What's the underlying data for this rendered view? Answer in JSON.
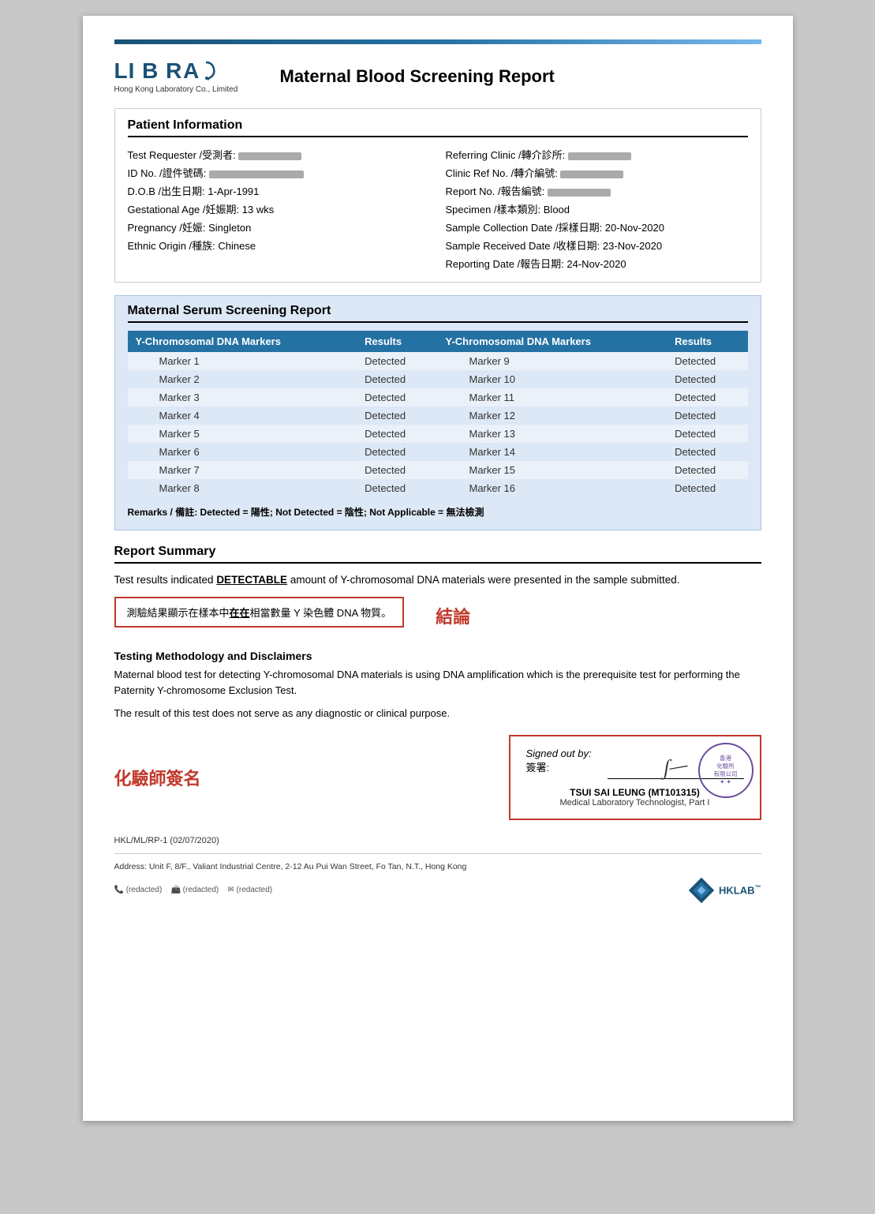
{
  "header": {
    "logo_name": "LIBRA",
    "logo_subtitle": "Hong Kong Laboratory Co., Limited",
    "report_title": "Maternal Blood Screening Report"
  },
  "patient_info": {
    "section_title": "Patient Information",
    "left": [
      {
        "label": "Test Requester /受測者:",
        "value": "BLURRED"
      },
      {
        "label": "ID No. /證件號碼:",
        "value": "BLURRED"
      },
      {
        "label": "D.O.B /出生日期:",
        "value": "1-Apr-1991"
      },
      {
        "label": "Gestational Age /妊娠期:",
        "value": "13 wks"
      },
      {
        "label": "Pregnancy /妊娠:",
        "value": "Singleton"
      },
      {
        "label": "Ethnic Origin /種族:",
        "value": "Chinese"
      }
    ],
    "right": [
      {
        "label": "Referring Clinic /轉介診所:",
        "value": "BLURRED"
      },
      {
        "label": "Clinic Ref No. /轉介編號:",
        "value": "BLURRED"
      },
      {
        "label": "Report No. /報告編號:",
        "value": "BLURRED"
      },
      {
        "label": "Specimen /樣本類別:",
        "value": "Blood"
      },
      {
        "label": "Sample Collection Date /採樣日期:",
        "value": "20-Nov-2020"
      },
      {
        "label": "Sample Received Date /收樣日期:",
        "value": "23-Nov-2020"
      },
      {
        "label": "Reporting Date /報告日期:",
        "value": "24-Nov-2020"
      }
    ]
  },
  "screening": {
    "section_title": "Maternal Serum Screening Report",
    "col1_header": "Y-Chromosomal DNA Markers",
    "col2_header": "Results",
    "col3_header": "Y-Chromosomal DNA Markers",
    "col4_header": "Results",
    "rows": [
      {
        "marker_left": "Marker 1",
        "result_left": "Detected",
        "marker_right": "Marker 9",
        "result_right": "Detected"
      },
      {
        "marker_left": "Marker 2",
        "result_left": "Detected",
        "marker_right": "Marker 10",
        "result_right": "Detected"
      },
      {
        "marker_left": "Marker 3",
        "result_left": "Detected",
        "marker_right": "Marker 11",
        "result_right": "Detected"
      },
      {
        "marker_left": "Marker 4",
        "result_left": "Detected",
        "marker_right": "Marker 12",
        "result_right": "Detected"
      },
      {
        "marker_left": "Marker 5",
        "result_left": "Detected",
        "marker_right": "Marker 13",
        "result_right": "Detected"
      },
      {
        "marker_left": "Marker 6",
        "result_left": "Detected",
        "marker_right": "Marker 14",
        "result_right": "Detected"
      },
      {
        "marker_left": "Marker 7",
        "result_left": "Detected",
        "marker_right": "Marker 15",
        "result_right": "Detected"
      },
      {
        "marker_left": "Marker 8",
        "result_left": "Detected",
        "marker_right": "Marker 16",
        "result_right": "Detected"
      }
    ],
    "remarks": "Remarks / 備註: Detected = 陽性; Not Detected = 陰性; Not Applicable = 無法檢測"
  },
  "report_summary": {
    "section_title": "Report Summary",
    "text_before": "Test results indicated ",
    "detectable_word": "DETECTABLE",
    "text_after": " amount of Y-chromosomal DNA materials were presented in the sample submitted.",
    "chinese_text": "測驗結果顯示在樣本中",
    "chinese_bold": "在在",
    "chinese_text2": "相當數量 Y 染色體 DNA 物質。",
    "jielun": "結論"
  },
  "methodology": {
    "title": "Testing Methodology and Disclaimers",
    "text1": "Maternal blood test for detecting Y-chromosomal DNA materials is using DNA amplification which is the prerequisite test for performing the Paternity Y-chromosome Exclusion Test.",
    "text2": "The result of this test does not serve as any diagnostic or clinical purpose."
  },
  "signature": {
    "chemist_label": "化驗師簽名",
    "signed_out_en": "Signed out by:",
    "signed_out_cn": "簽署:",
    "signer_name": "TSUI SAI LEUNG (MT101315)",
    "signer_title": "Medical Laboratory Technologist, Part I",
    "stamp_text": "香港化驗所有限公司"
  },
  "footer": {
    "doc_ref": "HKL/ML/RP-1 (02/07/2020)",
    "address": "Address: Unit F, 8/F., Valiant Industrial Centre, 2-12 Au Pui Wan Street, Fo Tan, N.T., Hong Kong",
    "contacts": "電話: (redacted)   傳真: (redacted)   電郵: (redacted)",
    "hklab": "HKLAB"
  }
}
